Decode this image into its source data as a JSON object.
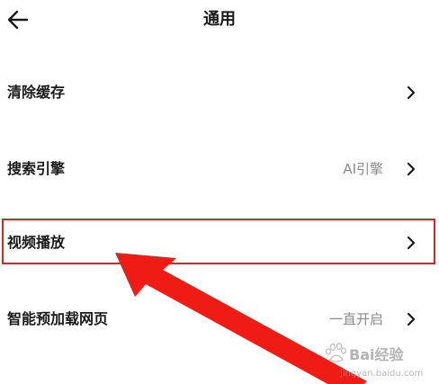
{
  "header": {
    "title": "通用",
    "back_icon": "arrow-left-icon"
  },
  "settings": [
    {
      "label": "清除缓存",
      "value": ""
    },
    {
      "label": "搜索引擎",
      "value": "AI引擎"
    },
    {
      "label": "视频播放",
      "value": ""
    },
    {
      "label": "智能预加载网页",
      "value": "一直开启"
    }
  ],
  "annotation": {
    "highlight_color": "#e0251c",
    "arrow_color": "#ee1c14",
    "highlighted_item": "视频播放"
  },
  "watermark": {
    "text": "Bai经验",
    "subtext": "jingyan.baidu.com"
  }
}
